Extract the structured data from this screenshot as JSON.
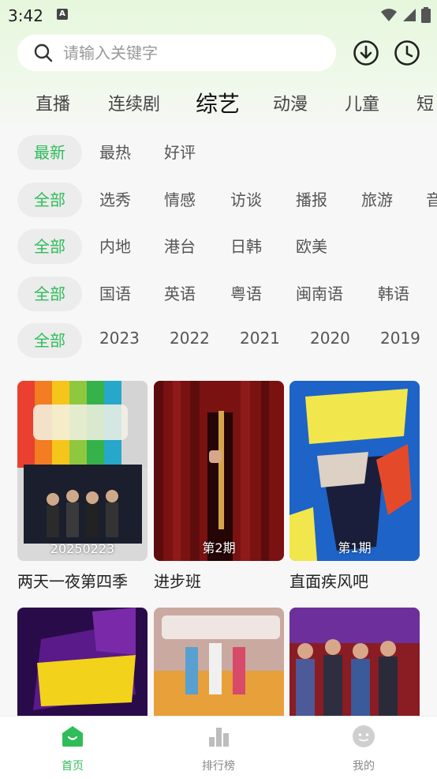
{
  "status": {
    "time": "3:42"
  },
  "search": {
    "placeholder": "请输入关键字"
  },
  "categories": [
    {
      "label": "直播"
    },
    {
      "label": "连续剧"
    },
    {
      "label": "综艺"
    },
    {
      "label": "动漫"
    },
    {
      "label": "儿童"
    },
    {
      "label": "短"
    }
  ],
  "active_category": "综艺",
  "filters": {
    "sort": [
      "最新",
      "最热",
      "好评"
    ],
    "type": [
      "全部",
      "选秀",
      "情感",
      "访谈",
      "播报",
      "旅游",
      "音"
    ],
    "region": [
      "全部",
      "内地",
      "港台",
      "日韩",
      "欧美"
    ],
    "language": [
      "全部",
      "国语",
      "英语",
      "粤语",
      "闽南语",
      "韩语"
    ],
    "year": [
      "全部",
      "2023",
      "2022",
      "2021",
      "2020",
      "2019"
    ]
  },
  "cards": [
    {
      "title": "两天一夜第四季",
      "badge": "20250223"
    },
    {
      "title": "进步班",
      "badge": "第2期"
    },
    {
      "title": "直面疾风吧",
      "badge": "第1期"
    }
  ],
  "bottom_nav": [
    {
      "label": "首页"
    },
    {
      "label": "排行榜"
    },
    {
      "label": "我的"
    }
  ],
  "colors": {
    "accent": "#2ebd59",
    "chip_bg": "#ececec"
  }
}
